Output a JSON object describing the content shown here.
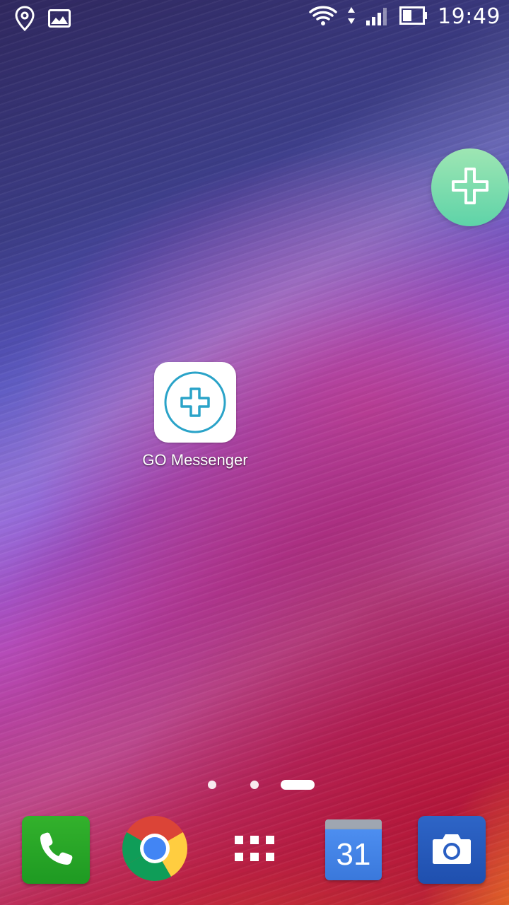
{
  "status_bar": {
    "left_icons": [
      "location-pin-icon",
      "gallery-image-icon"
    ],
    "right_icons": [
      "wifi-icon",
      "data-transfer-icon",
      "cellular-signal-icon",
      "battery-icon"
    ],
    "clock": "19:49"
  },
  "floating_button": {
    "icon": "plus-icon",
    "color": "#6fd9ad"
  },
  "home_screen": {
    "shortcuts": [
      {
        "label": "GO Messenger",
        "icon": "go-messenger-plus-icon",
        "accent": "#2aa3c8"
      }
    ],
    "page_count": 3,
    "active_page": 3
  },
  "dock": {
    "apps": [
      {
        "icon": "phone-icon",
        "color": "#2aa827"
      },
      {
        "icon": "chrome-icon"
      },
      {
        "icon": "app-drawer-icon"
      },
      {
        "icon": "calendar-icon",
        "date": "31",
        "color": "#4285f4"
      },
      {
        "icon": "camera-icon",
        "color": "#2a5fc3"
      }
    ]
  }
}
